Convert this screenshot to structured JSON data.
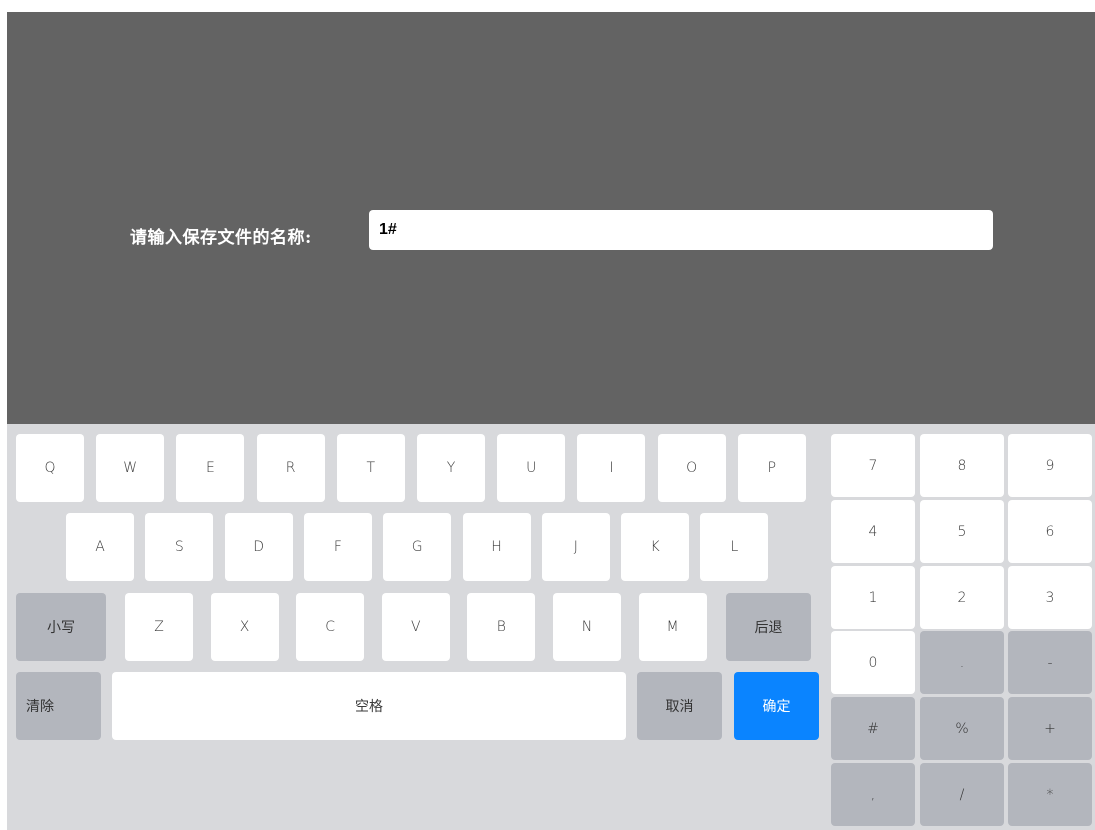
{
  "dialog": {
    "prompt": "请输入保存文件的名称:",
    "input_value": "1#"
  },
  "keyboard": {
    "row1": [
      "Q",
      "W",
      "E",
      "R",
      "T",
      "Y",
      "U",
      "I",
      "O",
      "P"
    ],
    "row2": [
      "A",
      "S",
      "D",
      "F",
      "G",
      "H",
      "J",
      "K",
      "L"
    ],
    "row3": [
      "Z",
      "X",
      "C",
      "V",
      "B",
      "N",
      "M"
    ],
    "lowercase": "小写",
    "backspace": "后退",
    "clear": "清除",
    "space": "空格",
    "cancel": "取消",
    "confirm": "确定",
    "numpad": [
      [
        "7",
        "8",
        "9"
      ],
      [
        "4",
        "5",
        "6"
      ],
      [
        "1",
        "2",
        "3"
      ],
      [
        "0",
        ".",
        "-"
      ],
      [
        "#",
        "%",
        "+"
      ],
      [
        ",",
        "/",
        "*"
      ]
    ],
    "colors": {
      "confirm": "#0a84ff",
      "function_key": "#b3b6bd",
      "background": "#d8d9dc",
      "dialog": "#636363"
    }
  }
}
